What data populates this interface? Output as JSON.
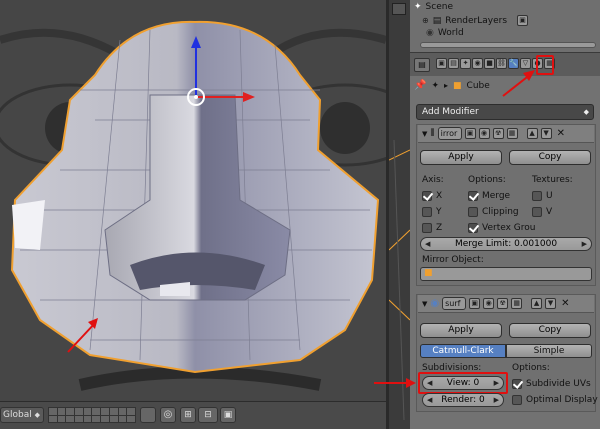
{
  "outliner": {
    "scene_label": "Scene",
    "renderlayers_label": "RenderLayers",
    "world_label": "World"
  },
  "properties": {
    "object_name": "Cube",
    "add_modifier_label": "Add Modifier",
    "mirror": {
      "name_value": "irror",
      "apply_label": "Apply",
      "copy_label": "Copy",
      "axis_label": "Axis:",
      "options_label": "Options:",
      "textures_label": "Textures:",
      "axis_x": "X",
      "axis_y": "Y",
      "axis_z": "Z",
      "merge_label": "Merge",
      "clipping_label": "Clipping",
      "vertex_groups_label": "Vertex Grou",
      "tex_u": "U",
      "tex_v": "V",
      "merge_limit": "Merge Limit: 0.001000",
      "mirror_object_label": "Mirror Object:"
    },
    "subsurf": {
      "name_value": "surf",
      "apply_label": "Apply",
      "copy_label": "Copy",
      "catmull_label": "Catmull-Clark",
      "simple_label": "Simple",
      "subdivisions_label": "Subdivisions:",
      "options_label": "Options:",
      "view_field": "View: 0",
      "render_field": "Render: 0",
      "subdivide_uvs_label": "Subdivide UVs",
      "optimal_display_label": "Optimal Display"
    }
  },
  "viewport_header": {
    "orientation_value": "Global"
  },
  "colors": {
    "accent_blue": "#5680c2",
    "highlight_red": "#e01010",
    "selection_orange": "#f0a030"
  }
}
